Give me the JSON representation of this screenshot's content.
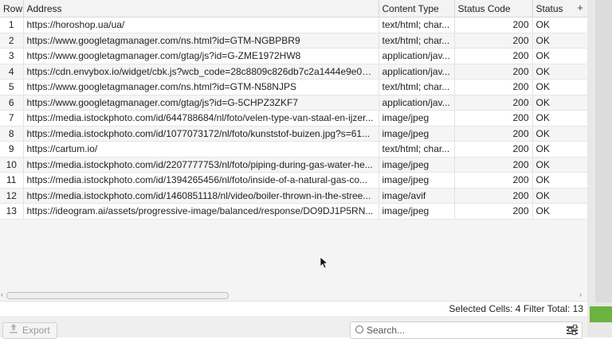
{
  "table": {
    "columns": [
      "Row",
      "Address",
      "Content Type",
      "Status Code",
      "Status"
    ],
    "add_column_symbol": "+",
    "rows": [
      {
        "row": "1",
        "address": "https://horoshop.ua/ua/",
        "content_type": "text/html; char...",
        "status_code": "200",
        "status": "OK"
      },
      {
        "row": "2",
        "address": "https://www.googletagmanager.com/ns.html?id=GTM-NGBPBR9",
        "content_type": "text/html; char...",
        "status_code": "200",
        "status": "OK"
      },
      {
        "row": "3",
        "address": "https://www.googletagmanager.com/gtag/js?id=G-ZME1972HW8",
        "content_type": "application/jav...",
        "status_code": "200",
        "status": "OK"
      },
      {
        "row": "4",
        "address": "https://cdn.envybox.io/widget/cbk.js?wcb_code=28c8809c826db7c2a1444e9e0b...",
        "content_type": "application/jav...",
        "status_code": "200",
        "status": "OK"
      },
      {
        "row": "5",
        "address": "https://www.googletagmanager.com/ns.html?id=GTM-N58NJPS",
        "content_type": "text/html; char...",
        "status_code": "200",
        "status": "OK"
      },
      {
        "row": "6",
        "address": "https://www.googletagmanager.com/gtag/js?id=G-5CHPZ3ZKF7",
        "content_type": "application/jav...",
        "status_code": "200",
        "status": "OK"
      },
      {
        "row": "7",
        "address": "https://media.istockphoto.com/id/644788684/nl/foto/velen-type-van-staal-en-ijzer...",
        "content_type": "image/jpeg",
        "status_code": "200",
        "status": "OK"
      },
      {
        "row": "8",
        "address": "https://media.istockphoto.com/id/1077073172/nl/foto/kunststof-buizen.jpg?s=61...",
        "content_type": "image/jpeg",
        "status_code": "200",
        "status": "OK"
      },
      {
        "row": "9",
        "address": "https://cartum.io/",
        "content_type": "text/html; char...",
        "status_code": "200",
        "status": "OK"
      },
      {
        "row": "10",
        "address": "https://media.istockphoto.com/id/2207777753/nl/foto/piping-during-gas-water-he...",
        "content_type": "image/jpeg",
        "status_code": "200",
        "status": "OK"
      },
      {
        "row": "11",
        "address": "https://media.istockphoto.com/id/1394265456/nl/foto/inside-of-a-natural-gas-co...",
        "content_type": "image/jpeg",
        "status_code": "200",
        "status": "OK"
      },
      {
        "row": "12",
        "address": "https://media.istockphoto.com/id/1460851118/nl/video/boiler-thrown-in-the-stree...",
        "content_type": "image/avif",
        "status_code": "200",
        "status": "OK"
      },
      {
        "row": "13",
        "address": "https://ideogram.ai/assets/progressive-image/balanced/response/DO9DJ1P5RN...",
        "content_type": "image/jpeg",
        "status_code": "200",
        "status": "OK"
      }
    ]
  },
  "status_bar": {
    "selected_cells_label": "Selected Cells:",
    "selected_cells_value": "4",
    "filter_total_label": "Filter Total:",
    "filter_total_value": "13"
  },
  "bottom": {
    "export_label": "Export",
    "search_placeholder": "Search..."
  },
  "icons": {
    "export": "upload-icon",
    "search": "search-icon",
    "filter": "filter-sliders-icon",
    "add_column": "plus-icon"
  },
  "colors": {
    "accent_green": "#6cb33f"
  }
}
